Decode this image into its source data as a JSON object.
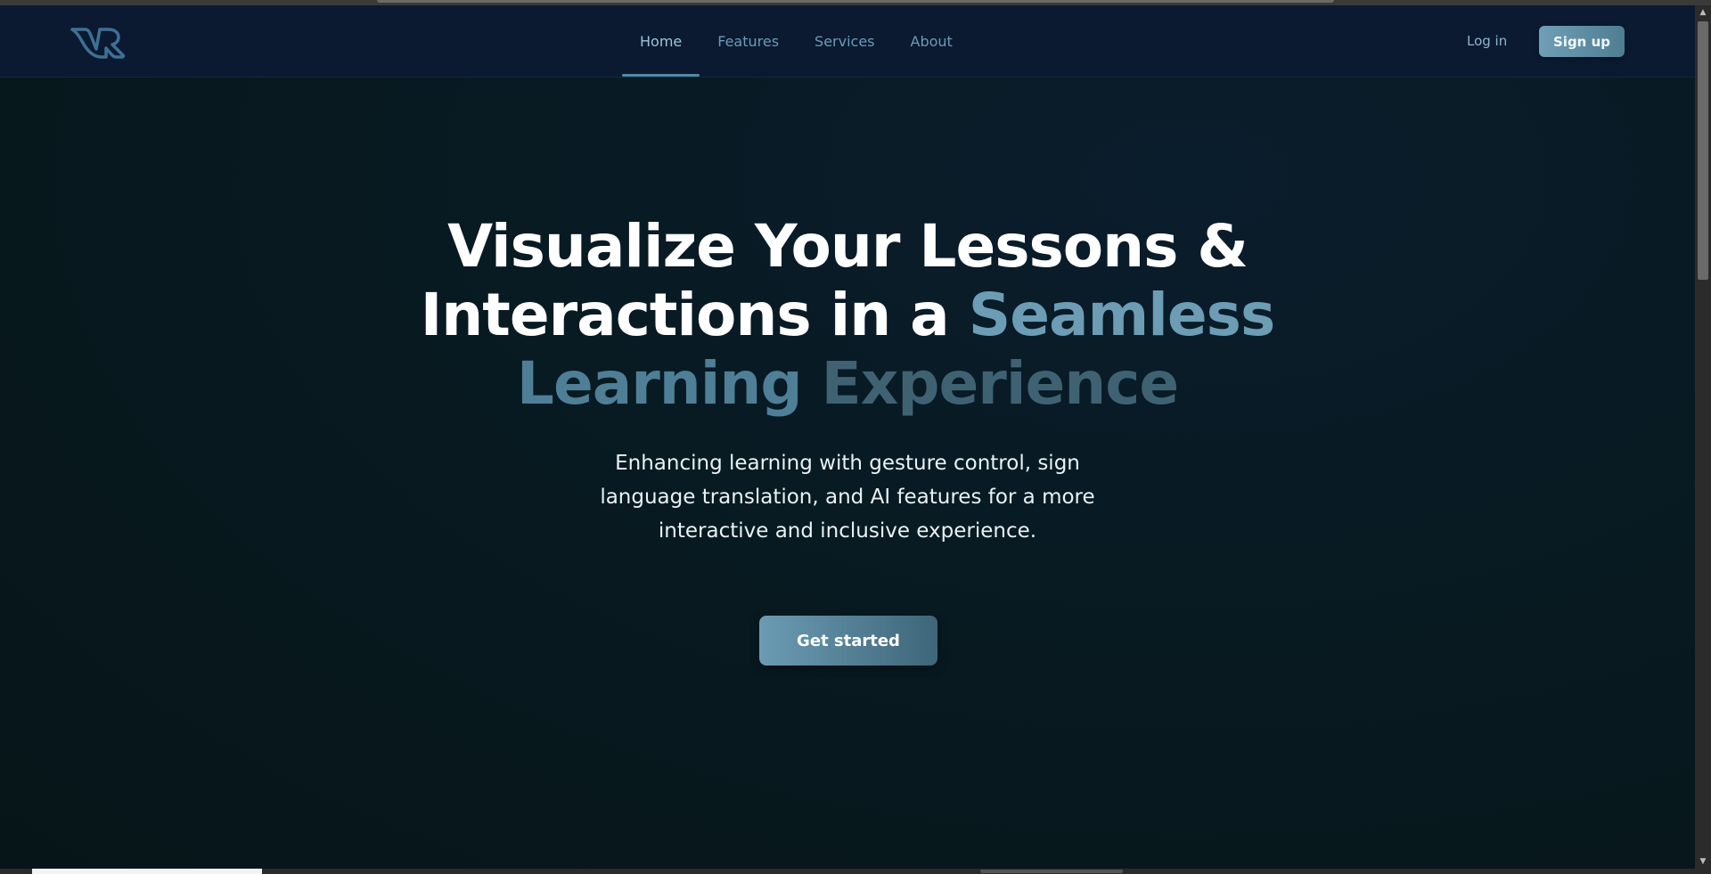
{
  "navbar": {
    "logo_name": "vk-logo",
    "links": [
      {
        "label": "Home",
        "active": true
      },
      {
        "label": "Features",
        "active": false
      },
      {
        "label": "Services",
        "active": false
      },
      {
        "label": "About",
        "active": false
      }
    ],
    "login_label": "Log in",
    "signup_label": "Sign up"
  },
  "hero": {
    "title_part1": "Visualize Your Lessons &",
    "title_part2": "Interactions in a ",
    "title_accent1": "Seamless",
    "title_accent2": "Learning ",
    "title_accent3": "Experience",
    "subtitle": "Enhancing learning with gesture control, sign language translation, and AI features for a more interactive and inclusive experience.",
    "cta_label": "Get started"
  },
  "colors": {
    "accent": "#6d9cb5",
    "nav_background": "#0b1a30",
    "page_background": "#07171d"
  }
}
